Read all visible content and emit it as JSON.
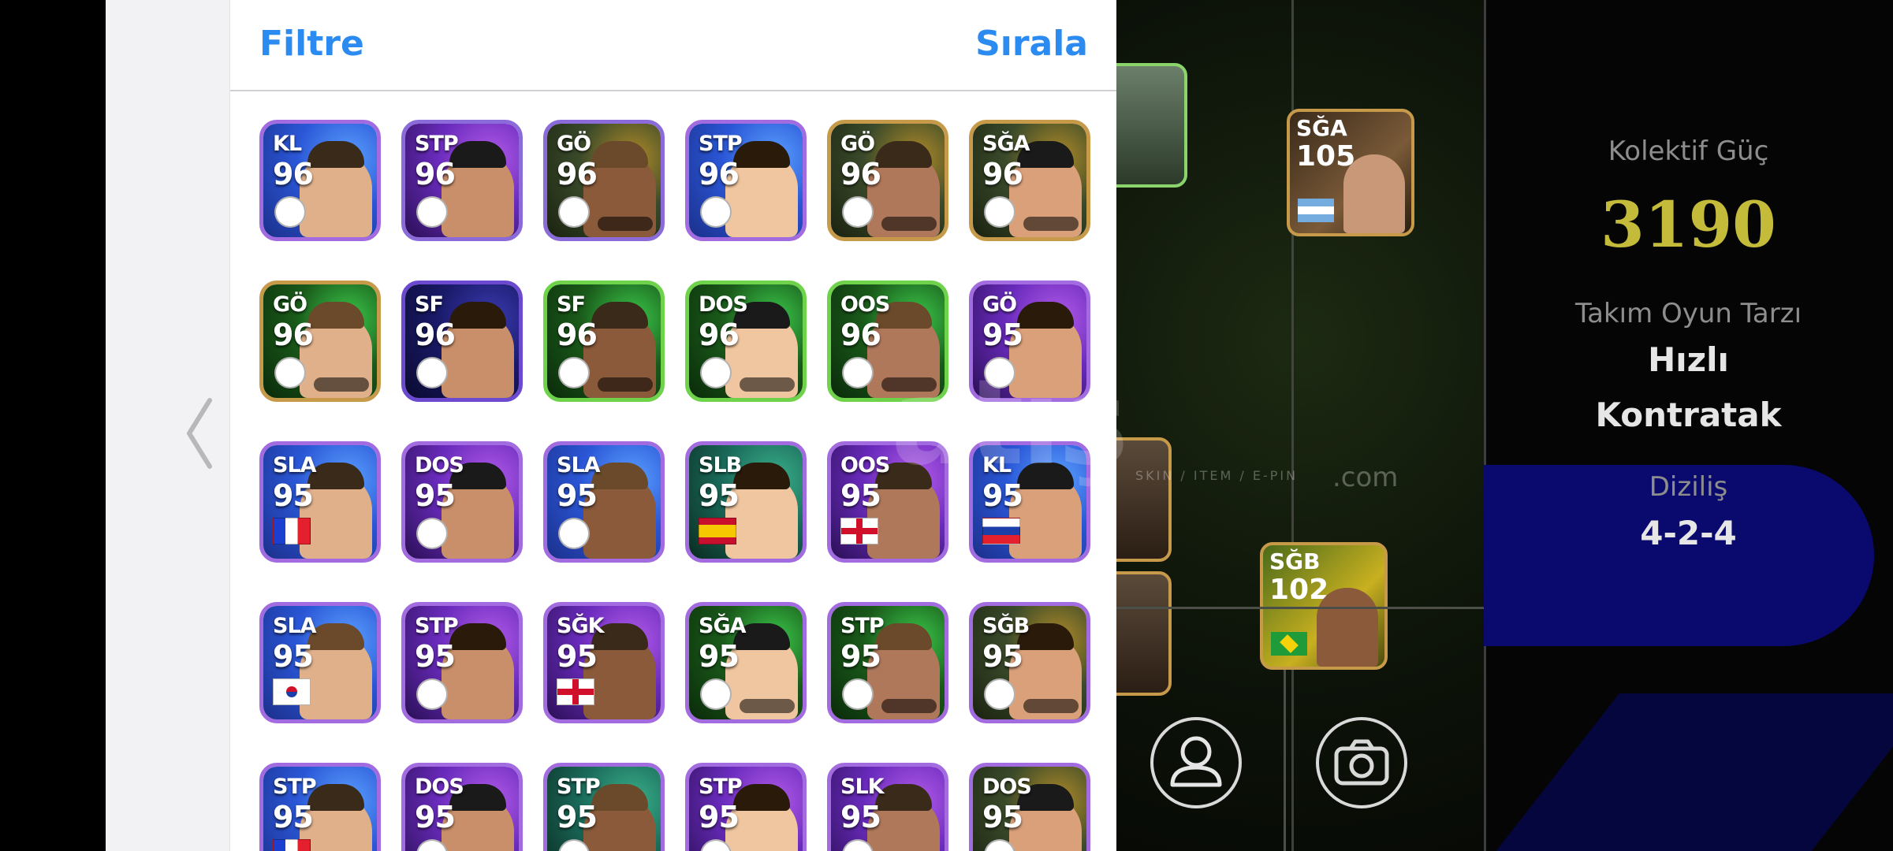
{
  "panel": {
    "filter_label": "Filtre",
    "sort_label": "Sırala"
  },
  "cards": [
    {
      "pos": "KL",
      "rating": "96",
      "theme": "blue",
      "border": "#a36be0",
      "mark": "badge"
    },
    {
      "pos": "STP",
      "rating": "96",
      "theme": "purple",
      "border": "#8a6bd9",
      "mark": "badge"
    },
    {
      "pos": "GÖ",
      "rating": "96",
      "theme": "gold",
      "border": "#8a6bd9",
      "mark": "badge"
    },
    {
      "pos": "STP",
      "rating": "96",
      "theme": "blue",
      "border": "#a36be0",
      "mark": "badge"
    },
    {
      "pos": "GÖ",
      "rating": "96",
      "theme": "gold",
      "border": "#c79a4a",
      "mark": "badge"
    },
    {
      "pos": "SĞA",
      "rating": "96",
      "theme": "gold",
      "border": "#c79a4a",
      "mark": "badge"
    },
    {
      "pos": "GÖ",
      "rating": "96",
      "theme": "green",
      "border": "#c79a4a",
      "mark": "badge"
    },
    {
      "pos": "SF",
      "rating": "96",
      "theme": "darkblue",
      "border": "#6b4ad0",
      "mark": "badge"
    },
    {
      "pos": "SF",
      "rating": "96",
      "theme": "green",
      "border": "#6ed24b",
      "mark": "badge"
    },
    {
      "pos": "DOS",
      "rating": "96",
      "theme": "green",
      "border": "#6ed24b",
      "mark": "badge"
    },
    {
      "pos": "OOS",
      "rating": "96",
      "theme": "green",
      "border": "#6ed24b",
      "mark": "badge"
    },
    {
      "pos": "GÖ",
      "rating": "95",
      "theme": "purple",
      "border": "#a36be0",
      "mark": "badge"
    },
    {
      "pos": "SLA",
      "rating": "95",
      "theme": "blue",
      "border": "#a36be0",
      "mark": "flag-fr"
    },
    {
      "pos": "DOS",
      "rating": "95",
      "theme": "purple",
      "border": "#a36be0",
      "mark": "badge"
    },
    {
      "pos": "SLA",
      "rating": "95",
      "theme": "blue",
      "border": "#a36be0",
      "mark": "badge"
    },
    {
      "pos": "SLB",
      "rating": "95",
      "theme": "teal",
      "border": "#a36be0",
      "mark": "flag-es"
    },
    {
      "pos": "OOS",
      "rating": "95",
      "theme": "purple",
      "border": "#a36be0",
      "mark": "flag-en"
    },
    {
      "pos": "KL",
      "rating": "95",
      "theme": "blue",
      "border": "#a36be0",
      "mark": "flag-si"
    },
    {
      "pos": "SLA",
      "rating": "95",
      "theme": "blue",
      "border": "#a36be0",
      "mark": "flag-kr"
    },
    {
      "pos": "STP",
      "rating": "95",
      "theme": "purple",
      "border": "#a36be0",
      "mark": "badge"
    },
    {
      "pos": "SĞK",
      "rating": "95",
      "theme": "purple",
      "border": "#a36be0",
      "mark": "flag-en"
    },
    {
      "pos": "SĞA",
      "rating": "95",
      "theme": "green",
      "border": "#a36be0",
      "mark": "badge"
    },
    {
      "pos": "STP",
      "rating": "95",
      "theme": "green",
      "border": "#a36be0",
      "mark": "badge"
    },
    {
      "pos": "SĞB",
      "rating": "95",
      "theme": "gold",
      "border": "#a36be0",
      "mark": "badge"
    },
    {
      "pos": "STP",
      "rating": "95",
      "theme": "blue",
      "border": "#a36be0",
      "mark": "flag-fr"
    },
    {
      "pos": "DOS",
      "rating": "95",
      "theme": "purple",
      "border": "#a36be0",
      "mark": "badge"
    },
    {
      "pos": "STP",
      "rating": "95",
      "theme": "teal",
      "border": "#a36be0",
      "mark": "badge"
    },
    {
      "pos": "STP",
      "rating": "95",
      "theme": "purple",
      "border": "#a36be0",
      "mark": "badge"
    },
    {
      "pos": "SLK",
      "rating": "95",
      "theme": "purple",
      "border": "#a36be0",
      "mark": "badge"
    },
    {
      "pos": "DOS",
      "rating": "95",
      "theme": "gold",
      "border": "#a36be0",
      "mark": "badge"
    }
  ],
  "pitch": {
    "cards": [
      {
        "pos": "SĞA",
        "rating": "105",
        "border": "#c79a4a"
      },
      {
        "pos": "SĞB",
        "rating": "102",
        "border": "#c79a4a"
      }
    ],
    "watermark": "atış",
    "watermark_sub": "SKIN / ITEM / E-PIN",
    "watermark_com": ".com"
  },
  "info": {
    "kolektif_label": "Kolektif Güç",
    "kolektif_value": "3190",
    "style_label": "Takım Oyun Tarzı",
    "style_value_1": "Hızlı",
    "style_value_2": "Kontratak",
    "formation_label": "Diziliş",
    "formation_value": "4-2-4"
  },
  "colors": {
    "accent": "#2b8bf0",
    "kolektif": "#c4bb3a"
  }
}
